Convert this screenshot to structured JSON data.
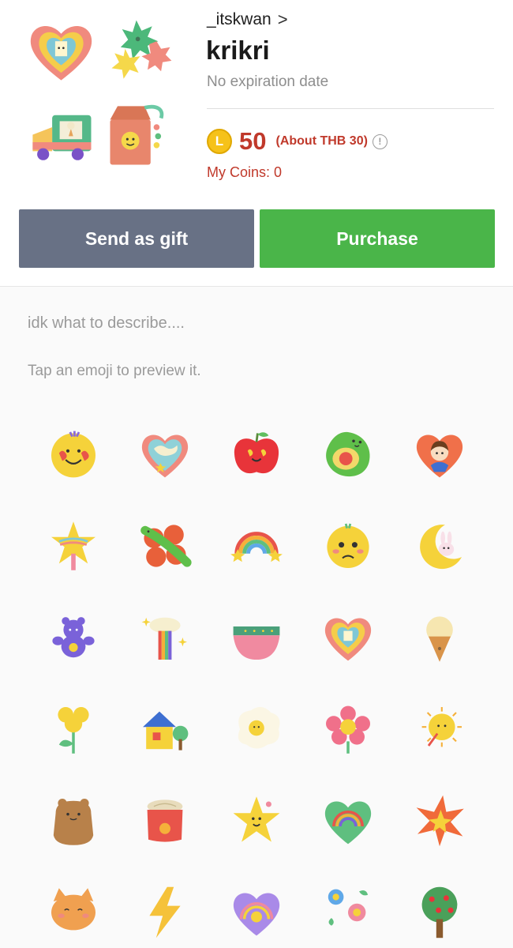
{
  "package": {
    "creator": "_itskwan",
    "creator_chevron": ">",
    "title": "krikri",
    "expiry": "No expiration date",
    "coin_symbol": "L",
    "price": "50",
    "about": "(About THB 30)",
    "info_symbol": "!",
    "my_coins": "My Coins: 0"
  },
  "buttons": {
    "gift": "Send as gift",
    "purchase": "Purchase"
  },
  "description": "idk what to describe....",
  "hint": "Tap an emoji to preview it.",
  "colors": {
    "accent_green": "#4ab549",
    "gift_gray": "#687185",
    "price_red": "#c0392b",
    "coin_gold": "#f6c21a"
  },
  "thumbnails": [
    "heart-frame-icon",
    "stars-icon",
    "ice-cream-truck-icon",
    "milk-carton-icon"
  ],
  "emojis": [
    "smiley-face-icon",
    "heart-icon",
    "apple-icon",
    "avocado-icon",
    "boy-heart-icon",
    "star-wand-icon",
    "clover-caterpillar-icon",
    "rainbow-icon",
    "worried-face-icon",
    "moon-bunny-icon",
    "purple-bear-icon",
    "rainbow-cloud-icon",
    "bowl-icon",
    "heart-frame-icon",
    "ice-cream-cone-icon",
    "yellow-flower-icon",
    "house-icon",
    "fried-egg-icon",
    "pink-flower-icon",
    "sun-icon",
    "brown-bear-icon",
    "jar-icon",
    "star-smiley-icon",
    "rainbow-heart-icon",
    "burst-icon",
    "cat-icon",
    "lightning-icon",
    "purple-heart-icon",
    "flowers-icon",
    "apple-tree-icon"
  ]
}
